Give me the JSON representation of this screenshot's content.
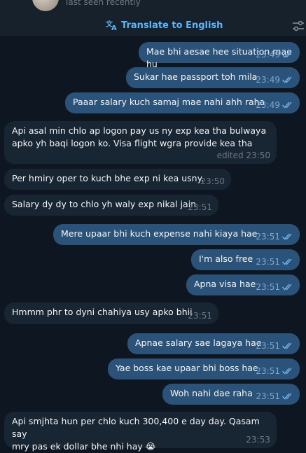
{
  "header": {
    "last_seen": "last seen recently",
    "translate_label": "Translate to English"
  },
  "messages": [
    {
      "dir": "out",
      "text": "Mae bhi aesae hee situation mae hu",
      "time": "23:49"
    },
    {
      "dir": "out",
      "text": "Sukar hae passport toh mila",
      "time": "23:49"
    },
    {
      "dir": "out",
      "text": "Paaar salary kuch samaj mae nahi ahh raha",
      "time": "23:49"
    },
    {
      "dir": "in",
      "text": "Api asal min chlo ap logon pay us ny exp kea tha bulwaya\napko yh baqi logon ko. Visa flight wgra provide kea tha",
      "time": "edited 23:50"
    },
    {
      "dir": "in",
      "text": "Per hmiry oper to kuch bhe exp ni kea usny.",
      "time": "23:50"
    },
    {
      "dir": "in",
      "text": "Salary dy dy to chlo yh waly exp nikal jain",
      "time": "23:51"
    },
    {
      "dir": "out",
      "text": "Mere upaar bhi kuch expense nahi kiaya hae",
      "time": "23:51"
    },
    {
      "dir": "out",
      "text": "I'm also free",
      "time": "23:51"
    },
    {
      "dir": "out",
      "text": "Apna visa hae",
      "time": "23:51"
    },
    {
      "dir": "in",
      "text": "Hmmm phr to dyni chahiya usy apko bhii",
      "time": "23:51"
    },
    {
      "dir": "out",
      "text": "Apnae salary sae lagaya hae",
      "time": "23:51"
    },
    {
      "dir": "out",
      "text": "Yae boss kae upaar bhi boss hae",
      "time": "23:51"
    },
    {
      "dir": "out",
      "text": "Woh nahi dae raha",
      "time": "23:51"
    },
    {
      "dir": "in",
      "text": "Api smjhta hun per chlo kuch 300,400 e day day. Qasam say\nmry pas ek dollar bhe nhi hay 😭",
      "time": "23:53"
    }
  ],
  "colors": {
    "background": "#0e1621",
    "outgoing_bubble": "#2b5278",
    "incoming_bubble": "#182533",
    "accent": "#5eb5f7"
  }
}
